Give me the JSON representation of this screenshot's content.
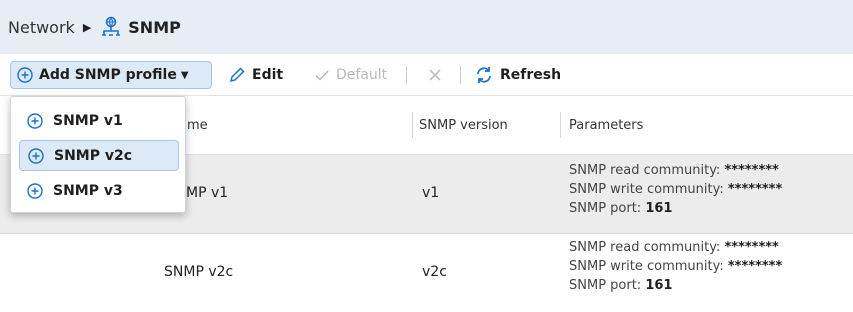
{
  "breadcrumb": {
    "root": "Network",
    "current": "SNMP"
  },
  "toolbar": {
    "add_label": "Add SNMP profile",
    "edit_label": "Edit",
    "default_label": "Default",
    "refresh_label": "Refresh"
  },
  "table": {
    "columns": [
      "me",
      "SNMP version",
      "Parameters"
    ],
    "rows": [
      {
        "name": "MP v1",
        "version": "v1",
        "params": {
          "read_label": "SNMP read community:",
          "read_value": "********",
          "write_label": "SNMP write community:",
          "write_value": "********",
          "port_label": "SNMP port:",
          "port_value": "161"
        }
      },
      {
        "name": "SNMP v2c",
        "version": "v2c",
        "params": {
          "read_label": "SNMP read community:",
          "read_value": "********",
          "write_label": "SNMP write community:",
          "write_value": "********",
          "port_label": "SNMP port:",
          "port_value": "161"
        }
      }
    ]
  },
  "menu": {
    "items": [
      "SNMP v1",
      "SNMP v2c",
      "SNMP v3"
    ],
    "highlighted": "SNMP v2c"
  },
  "colors": {
    "accent": "#1a73c9",
    "header_bg": "#e7edf5",
    "selected_row": "#ececec"
  },
  "icons": [
    "snmp-network-icon",
    "plus-circle-icon",
    "pencil-icon",
    "check-icon",
    "close-icon",
    "refresh-icon",
    "caret-down-icon",
    "caret-right-icon"
  ]
}
